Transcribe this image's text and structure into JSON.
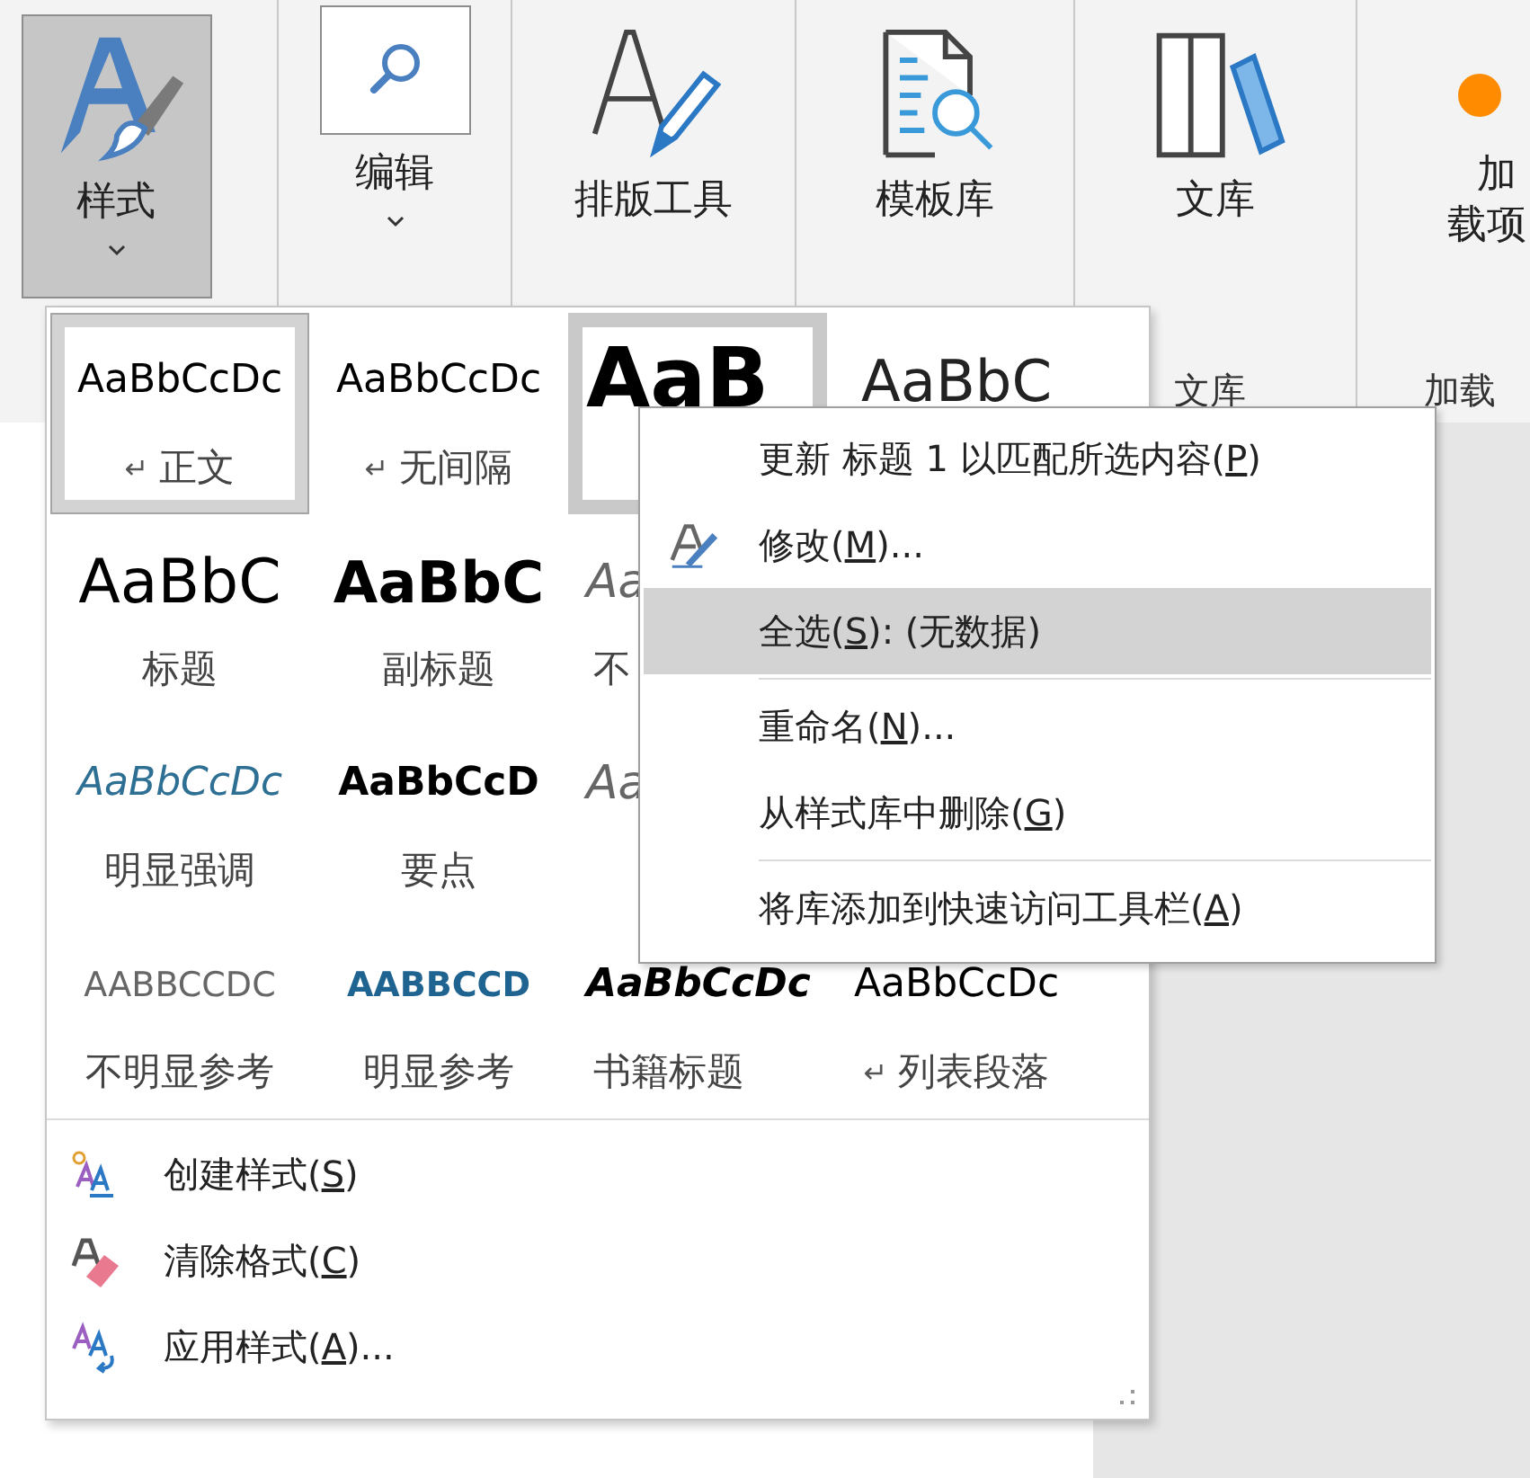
{
  "ribbon": {
    "buttons": [
      {
        "kind": "styles",
        "label": "样式",
        "dropdown": true,
        "selected": true
      },
      {
        "kind": "find",
        "label": "编辑",
        "dropdown": true,
        "selected": false
      },
      {
        "kind": "pen",
        "label": "排版工具",
        "dropdown": false,
        "selected": false
      },
      {
        "kind": "template",
        "label": "模板库",
        "dropdown": false,
        "selected": false
      },
      {
        "kind": "library",
        "label": "文库",
        "dropdown": false,
        "selected": false,
        "group_label": "文库"
      },
      {
        "kind": "addin",
        "label": "加载项",
        "dropdown": false,
        "selected": false,
        "group_label": "加载"
      }
    ]
  },
  "gallery": {
    "rows": [
      [
        {
          "kind": "body",
          "sample": "AaBbCcDc",
          "mark": "↵",
          "label": "正文",
          "selected": true,
          "highlighted": false
        },
        {
          "kind": "body",
          "sample": "AaBbCcDc",
          "mark": "↵",
          "label": "无间隔",
          "selected": false,
          "highlighted": false
        },
        {
          "kind": "heading1",
          "sample": "AaB",
          "selected": false,
          "highlighted": true
        },
        {
          "kind": "heading2",
          "sample": "AaBbC",
          "selected": false,
          "highlighted": false
        }
      ],
      [
        {
          "kind": "title",
          "sample": "AaBbC",
          "label": "标题",
          "selected": false,
          "highlighted": false
        },
        {
          "kind": "subtitle",
          "sample": "AaBbC",
          "label": "副标题",
          "selected": false,
          "highlighted": false
        },
        {
          "kind": "subtle-emphasis",
          "sample": "Aa",
          "label": "不",
          "selected": false,
          "highlighted": false
        }
      ],
      [
        {
          "kind": "intense-emphasis",
          "sample": "AaBbCcDc",
          "label": "明显强调",
          "selected": false,
          "highlighted": false
        },
        {
          "kind": "strong",
          "sample": "AaBbCcD",
          "label": "要点",
          "selected": false,
          "highlighted": false
        },
        {
          "kind": "subtle-emphasis",
          "sample": "Aa",
          "selected": false,
          "highlighted": false
        }
      ],
      [
        {
          "kind": "subtle-reference",
          "sample": "AABBCCDC",
          "label": "不明显参考",
          "selected": false,
          "highlighted": false
        },
        {
          "kind": "intense-reference",
          "sample": "AABBCCD",
          "label": "明显参考",
          "selected": false,
          "highlighted": false
        },
        {
          "kind": "book-title",
          "sample": "AaBbCcDc",
          "label": "书籍标题",
          "selected": false,
          "highlighted": false
        },
        {
          "kind": "body",
          "sample": "AaBbCcDc",
          "mark": "↵",
          "label": "列表段落",
          "selected": false,
          "highlighted": false
        }
      ]
    ],
    "commands": [
      {
        "kind": "new-style",
        "before": "创建样式(",
        "key": "S",
        "after": ")"
      },
      {
        "kind": "clear",
        "before": "清除格式(",
        "key": "C",
        "after": ")"
      },
      {
        "kind": "apply",
        "before": "应用样式(",
        "key": "A",
        "after": ")..."
      }
    ]
  },
  "context_menu": {
    "items": [
      {
        "kind": "command",
        "before": "更新 标题 1 以匹配所选内容(",
        "key": "P",
        "after": ")",
        "selected": false
      },
      {
        "kind": "edit",
        "before": "修改(",
        "key": "M",
        "after": ")...",
        "selected": false
      },
      {
        "kind": "command",
        "before": "全选(",
        "key": "S",
        "after": "): (无数据)",
        "selected": true
      },
      {
        "kind": "separator"
      },
      {
        "kind": "command",
        "before": "重命名(",
        "key": "N",
        "after": ")...",
        "selected": false
      },
      {
        "kind": "command",
        "before": "从样式库中删除(",
        "key": "G",
        "after": ")",
        "selected": false
      },
      {
        "kind": "separator"
      },
      {
        "kind": "command",
        "before": "将库添加到快速访问工具栏(",
        "key": "A",
        "after": ")",
        "selected": false
      }
    ]
  }
}
